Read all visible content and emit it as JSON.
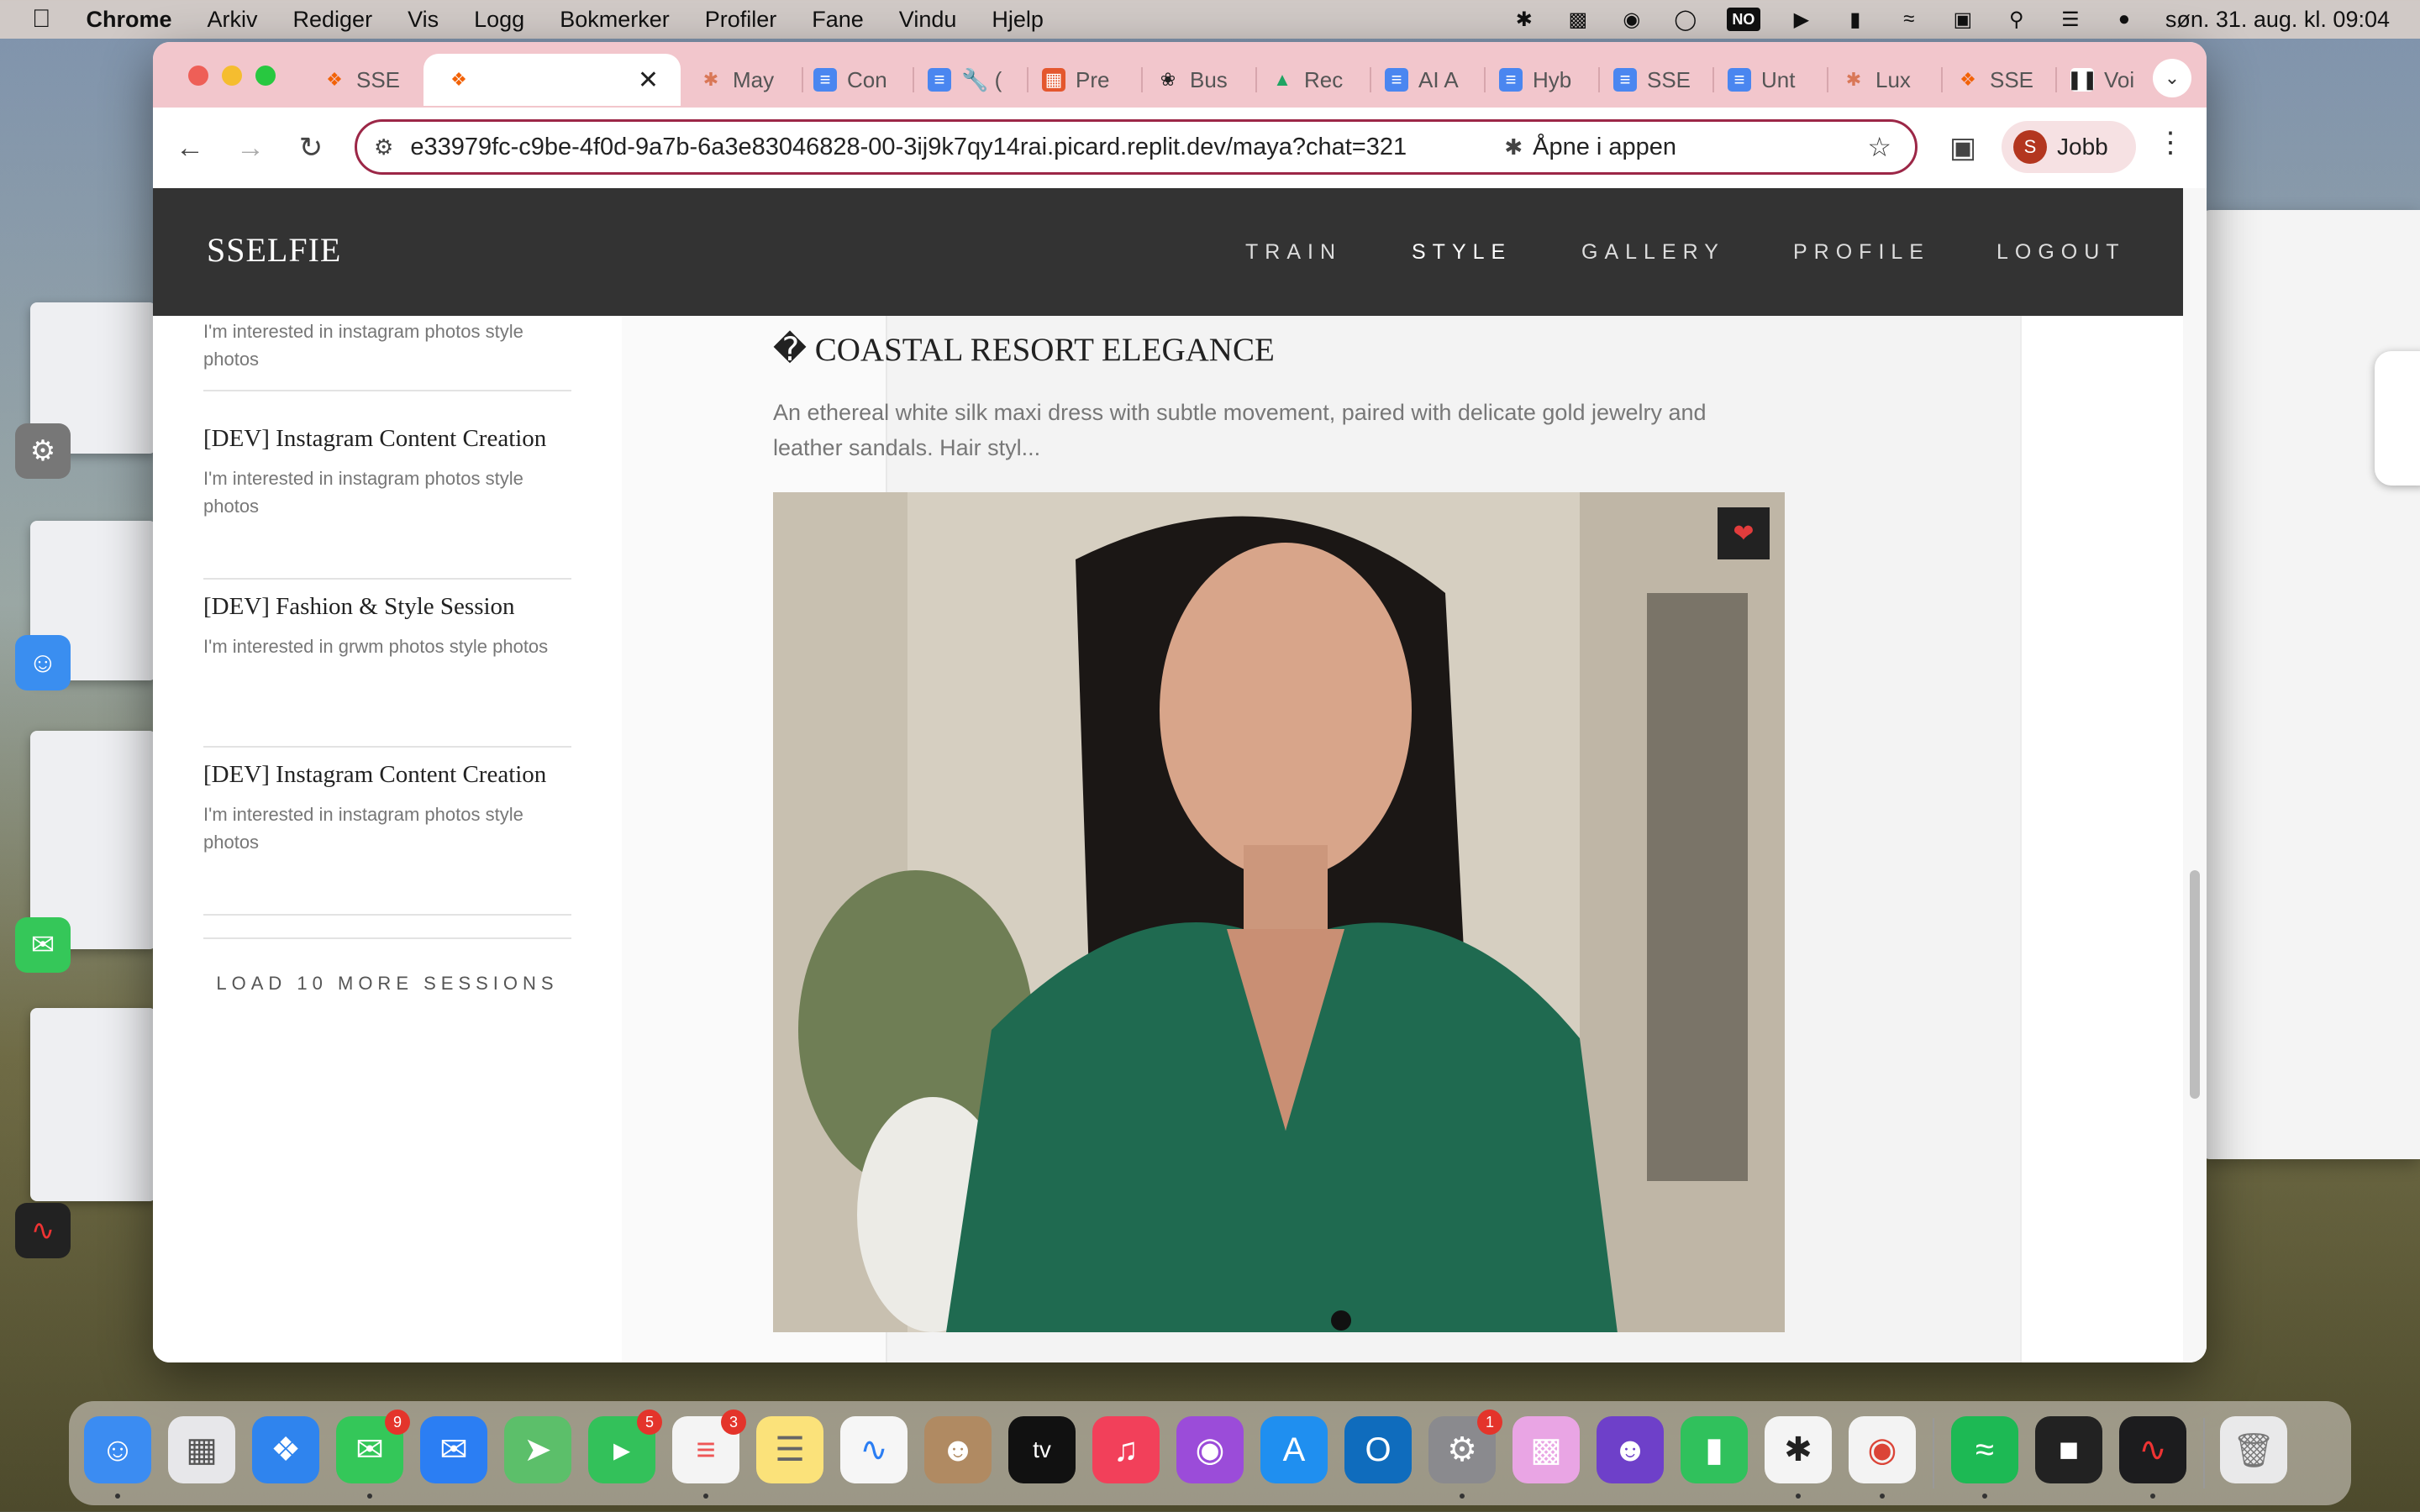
{
  "menubar": {
    "app": "Chrome",
    "items": [
      "Arkiv",
      "Rediger",
      "Vis",
      "Logg",
      "Bokmerker",
      "Profiler",
      "Fane",
      "Vindu",
      "Hjelp"
    ],
    "clock": "søn. 31. aug. kl. 09:04",
    "no_badge": "NO"
  },
  "tabs": [
    {
      "label": "SSE",
      "icon": "replit-icon"
    },
    {
      "label": "",
      "icon": "replit-icon",
      "active": true
    },
    {
      "label": "May",
      "icon": "claude-icon"
    },
    {
      "label": "Con",
      "icon": "docs-icon"
    },
    {
      "label": "🔧 (",
      "icon": "docs-icon"
    },
    {
      "label": "Pre",
      "icon": "slides-icon"
    },
    {
      "label": "Bus",
      "icon": "openai-icon"
    },
    {
      "label": "Rec",
      "icon": "drive-icon"
    },
    {
      "label": "AI A",
      "icon": "docs-icon"
    },
    {
      "label": "Hyb",
      "icon": "docs-icon"
    },
    {
      "label": "SSE",
      "icon": "docs-icon"
    },
    {
      "label": "Unt",
      "icon": "docs-icon"
    },
    {
      "label": "Lux",
      "icon": "claude-icon"
    },
    {
      "label": "SSE",
      "icon": "replit-icon"
    },
    {
      "label": "Voi",
      "icon": "pause-icon"
    }
  ],
  "address": {
    "url": "e33979fc-c9be-4f0d-9a7b-6a3e83046828-00-3ij9k7qy14rai.picard.replit.dev/maya?chat=321",
    "open_in_app": "Åpne i appen",
    "profile_initial": "S",
    "profile_name": "Jobb"
  },
  "site": {
    "brand": "SSELFIE",
    "nav": [
      "TRAIN",
      "STYLE",
      "GALLERY",
      "PROFILE",
      "LOGOUT"
    ],
    "partial_session_desc": "I'm interested in instagram photos style photos",
    "sessions": [
      {
        "title": "[DEV] Instagram Content Creation",
        "desc": "I'm interested in instagram photos style photos"
      },
      {
        "title": "[DEV] Fashion & Style Session",
        "desc": "I'm interested in grwm photos style photos"
      },
      {
        "title": "[DEV] Instagram Content Creation",
        "desc": "I'm interested in instagram photos style photos"
      }
    ],
    "load_more": "LOAD 10 MORE SESSIONS",
    "look": {
      "title": "� COASTAL RESORT ELEGANCE",
      "desc": "An ethereal white silk maxi dress with subtle movement, paired with delicate gold jewelry and leather sandals. Hair styl..."
    }
  },
  "dock": {
    "badges": {
      "messages": "9",
      "facetime": "5",
      "reminders": "3",
      "settings": "1"
    }
  },
  "colors": {
    "accent": "#9c2747",
    "tabbar": "#f2c6cc",
    "site_nav": "#333333",
    "heart": "#e23c3c"
  }
}
